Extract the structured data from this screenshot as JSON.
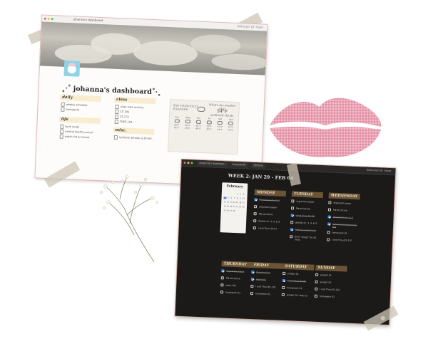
{
  "light": {
    "tab_title": "johanna's dashboard",
    "top_right": [
      "Edited Jan 29",
      "Share"
    ],
    "title": "˳·˚ johanna's dashboard˚·˳",
    "sections": [
      {
        "header": "daily",
        "items": [
          "weekly schedule",
          "homework"
        ]
      },
      {
        "header": "class",
        "items": [
          "class note archive",
          "CS 186",
          "CS 272",
          "THEE 104"
        ]
      },
      {
        "header": "life",
        "items": [
          "work study",
          "mental health journal",
          "watch list & tracker"
        ]
      },
      {
        "header": "misc.",
        "items": [
          "symbols, Emojis, & Emoti..."
        ]
      }
    ],
    "weather": {
      "city": "SAN FRANCISCO",
      "label": "WEATHER",
      "note": "What's the weather like?",
      "temp": "54°F",
      "desc": "scattered clouds",
      "days": [
        "Tue",
        "Wed",
        "Thu",
        "Fri",
        "Sat",
        "Sun"
      ],
      "highs": [
        "56°F",
        "56°F",
        "56°F",
        "56°F",
        "57°F",
        "57°F"
      ],
      "lows": [
        "45°F",
        "45°F",
        "46°F",
        "45°F",
        "45°F",
        "44°F"
      ]
    },
    "help": "?"
  },
  "dark": {
    "tabs": [
      "johanna's dashboar...",
      "homework",
      "archive"
    ],
    "top_right": [
      "Edited Jan 29",
      "Share"
    ],
    "title": "WEEK 2: JAN 29 - FEB 04",
    "calendar": {
      "month": "February",
      "days": [
        "",
        "",
        "",
        "",
        "1",
        "2",
        "3",
        "4",
        "5",
        "6",
        "7",
        "8",
        "9",
        "10",
        "11",
        "12",
        "13",
        "14",
        "15",
        "16",
        "17",
        "18",
        "19",
        "20",
        "21",
        "22",
        "23",
        "24",
        "25",
        "26",
        "27",
        "28"
      ],
      "today": "4"
    },
    "days": [
      {
        "name": "MONDAY",
        "tasks": [
          {
            "text": "discussion ch. 4, 5",
            "done": true
          },
          {
            "text": "argument paper",
            "done": false
          },
          {
            "text": "file structure",
            "done": false
          },
          {
            "text": "docket ch. 3, 4, & 5",
            "done": false
          },
          {
            "text": "I and Thou 54-67",
            "done": false
          }
        ]
      },
      {
        "name": "TUESDAY",
        "tasks": [
          {
            "text": "argument paper",
            "done": false
          },
          {
            "text": "file structure",
            "done": false
          },
          {
            "text": "I and Thou 62-80",
            "done": true
          },
          {
            "text": "docket ch. 3, 4, & 5",
            "done": false
          },
          {
            "text": "intro to vocab data",
            "done": true
          },
          {
            "text": "Emit \"grasp\" for 20 mins",
            "done": false
          }
        ]
      },
      {
        "name": "WEDNESDAY",
        "tasks": [
          {
            "text": "argument paper",
            "done": false
          },
          {
            "text": "file structure",
            "done": false
          },
          {
            "text": "discussion ch. 4, 5",
            "done": true
          },
          {
            "text": "lecture (programming 01)",
            "done": true
          },
          {
            "text": "homework 01",
            "done": false
          },
          {
            "text": "I and Thou 81-107",
            "done": false
          }
        ]
      },
      {
        "name": "THURSDAY",
        "tasks": [
          {
            "text": "argument paper",
            "done": true
          },
          {
            "text": "file structure",
            "done": false
          },
          {
            "text": "report 02",
            "done": false
          },
          {
            "text": "homework 01",
            "done": false
          }
        ]
      },
      {
        "name": "FRIDAY",
        "tasks": [
          {
            "text": "file structure",
            "done": true
          },
          {
            "text": "report 01",
            "done": true
          },
          {
            "text": "I and Thou 81-107",
            "done": false
          },
          {
            "text": "homework 01",
            "done": false
          }
        ]
      },
      {
        "name": "SATURDAY",
        "tasks": [
          {
            "text": "project 01",
            "done": false
          },
          {
            "text": "I and Thou 67-80",
            "done": true
          },
          {
            "text": "homework 01",
            "done": false
          },
          {
            "text": "project 01: step 01",
            "done": false
          }
        ]
      },
      {
        "name": "SUNDAY",
        "tasks": [
          {
            "text": "project 01",
            "done": false
          },
          {
            "text": "project 01",
            "done": false
          },
          {
            "text": "I and Thou 81-107",
            "done": false
          },
          {
            "text": "homework 01",
            "done": false
          }
        ]
      }
    ],
    "help": "?"
  }
}
